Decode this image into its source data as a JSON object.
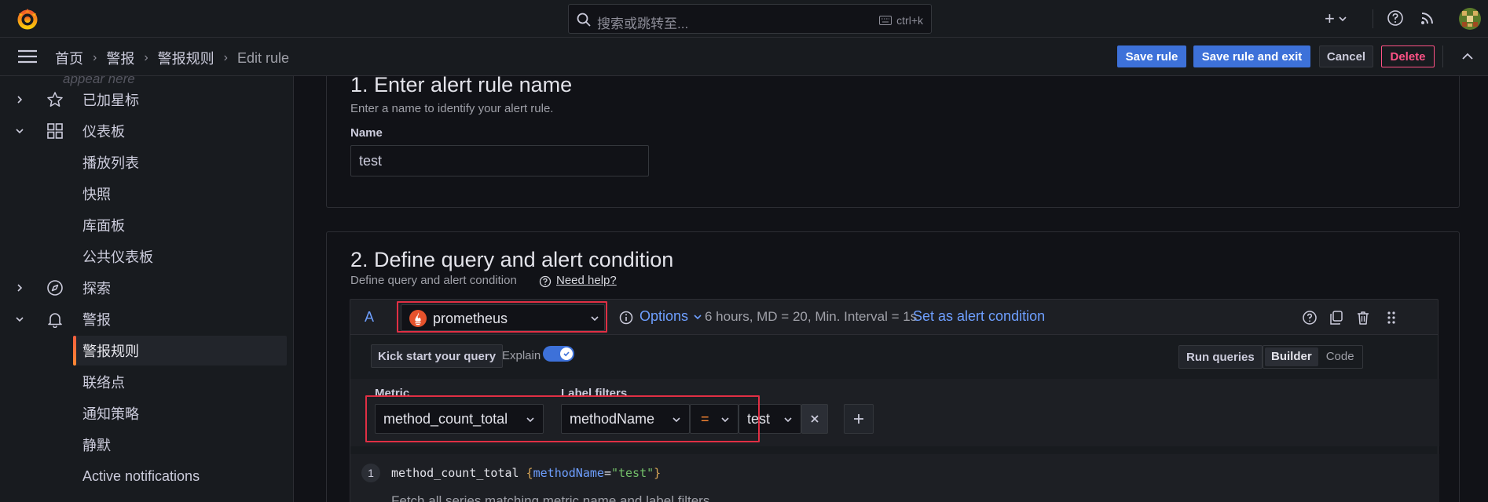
{
  "topbar": {
    "search_placeholder": "搜索或跳转至...",
    "search_shortcut": "ctrl+k",
    "plus_label": "+"
  },
  "breadcrumb": [
    "首页",
    "警报",
    "警报规则",
    "Edit rule"
  ],
  "actions": {
    "save_rule": "Save rule",
    "save_rule_exit": "Save rule and exit",
    "cancel": "Cancel",
    "delete": "Delete"
  },
  "sidebar": {
    "faded_text": "appear here",
    "items": [
      {
        "label": "已加星标",
        "icon": "star-icon",
        "expand": "collapsed"
      },
      {
        "label": "仪表板",
        "icon": "dashboards-icon",
        "expand": "expanded"
      },
      {
        "label": "播放列表",
        "sub": true
      },
      {
        "label": "快照",
        "sub": true
      },
      {
        "label": "库面板",
        "sub": true
      },
      {
        "label": "公共仪表板",
        "sub": true
      },
      {
        "label": "探索",
        "icon": "compass-icon",
        "expand": "collapsed"
      },
      {
        "label": "警报",
        "icon": "bell-icon",
        "expand": "expanded"
      },
      {
        "label": "警报规则",
        "sub": true,
        "active": true
      },
      {
        "label": "联络点",
        "sub": true
      },
      {
        "label": "通知策略",
        "sub": true
      },
      {
        "label": "静默",
        "sub": true
      },
      {
        "label": "Active notifications",
        "sub": true
      }
    ]
  },
  "section1": {
    "title": "1. Enter alert rule name",
    "description": "Enter a name to identify your alert rule.",
    "name_label": "Name",
    "name_value": "test"
  },
  "section2": {
    "title": "2. Define query and alert condition",
    "description": "Define query and alert condition",
    "help_link": "Need help?",
    "query": {
      "letter": "A",
      "datasource": "prometheus",
      "options_label": "Options",
      "options_meta": "6 hours, MD = 20, Min. Interval = 1s",
      "alert_condition": "Set as alert condition",
      "kick_start": "Kick start your query",
      "explain_label": "Explain",
      "explain_on": true,
      "run_queries": "Run queries",
      "mode_builder": "Builder",
      "mode_code": "Code",
      "metric_label": "Metric",
      "metric_value": "method_count_total",
      "label_filters_label": "Label filters",
      "filter_key": "methodName",
      "filter_op": "=",
      "filter_value": "test",
      "code_line_no": "1",
      "code_metric": "method_count_total",
      "code_open": "{",
      "code_key": "methodName",
      "code_eq": "=",
      "code_val": "\"test\"",
      "code_close": "}",
      "code_description": "Fetch all series matching metric name and label filters."
    }
  },
  "colors": {
    "accent_blue": "#3d71d9",
    "link_blue": "#6e9fff",
    "danger": "#ff5286",
    "highlight_red": "#e02f44",
    "brand_orange": "#f55f3e"
  }
}
